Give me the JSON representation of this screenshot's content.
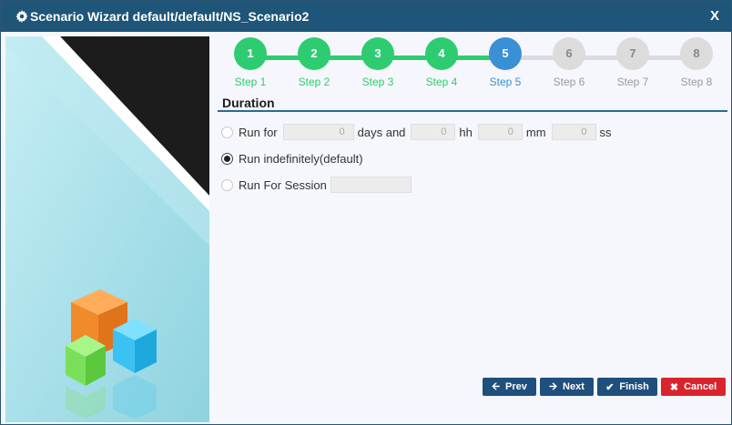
{
  "window": {
    "title": "Scenario Wizard default/default/NS_Scenario2",
    "close_label": "X",
    "icon": "gear-icon"
  },
  "wizard": {
    "steps": [
      {
        "number": "1",
        "label": "Step 1",
        "state": "done"
      },
      {
        "number": "2",
        "label": "Step 2",
        "state": "done"
      },
      {
        "number": "3",
        "label": "Step 3",
        "state": "done"
      },
      {
        "number": "4",
        "label": "Step 4",
        "state": "done"
      },
      {
        "number": "5",
        "label": "Step 5",
        "state": "active"
      },
      {
        "number": "6",
        "label": "Step 6",
        "state": "todo"
      },
      {
        "number": "7",
        "label": "Step 7",
        "state": "todo"
      },
      {
        "number": "8",
        "label": "Step 8",
        "state": "todo"
      }
    ],
    "colors": {
      "done": "#2ecc71",
      "active": "#3b8fd5",
      "todo": "#dcdcdc"
    }
  },
  "duration": {
    "heading": "Duration",
    "run_for": {
      "label": "Run for",
      "days_value": "0",
      "days_label": "days and",
      "hh_value": "0",
      "hh_label": "hh",
      "mm_value": "0",
      "mm_label": "mm",
      "ss_value": "0",
      "ss_label": "ss",
      "checked": false
    },
    "run_indefinitely": {
      "label": "Run indefinitely(default)",
      "checked": true
    },
    "run_for_session": {
      "label": "Run For Session",
      "value": "",
      "checked": false
    }
  },
  "buttons": {
    "prev": {
      "label": "Prev",
      "icon": "arrow-left-icon"
    },
    "next": {
      "label": "Next",
      "icon": "arrow-right-icon"
    },
    "finish": {
      "label": "Finish",
      "icon": "check-icon"
    },
    "cancel": {
      "label": "Cancel",
      "icon": "x-icon"
    }
  }
}
